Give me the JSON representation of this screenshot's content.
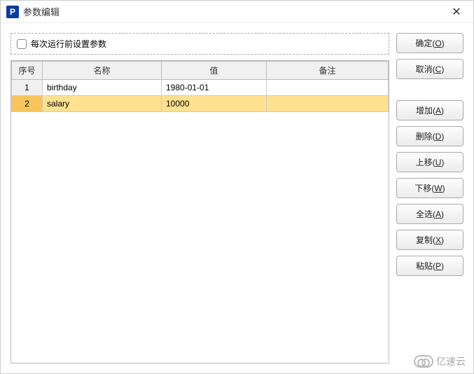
{
  "window": {
    "title": "参数编辑",
    "icon_letter": "P"
  },
  "checkbox": {
    "label": "每次运行前设置参数",
    "checked": false
  },
  "table": {
    "headers": {
      "seq": "序号",
      "name": "名称",
      "value": "值",
      "remark": "备注"
    },
    "rows": [
      {
        "seq": "1",
        "name": "birthday",
        "value": "1980-01-01",
        "remark": "",
        "selected": false
      },
      {
        "seq": "2",
        "name": "salary",
        "value": "10000",
        "remark": "",
        "selected": true
      }
    ]
  },
  "buttons": {
    "ok": {
      "text": "确定(",
      "key": "O",
      "suffix": ")"
    },
    "cancel": {
      "text": "取消(",
      "key": "C",
      "suffix": ")"
    },
    "add": {
      "text": "增加(",
      "key": "A",
      "suffix": ")"
    },
    "delete": {
      "text": "删除(",
      "key": "D",
      "suffix": ")"
    },
    "up": {
      "text": "上移(",
      "key": "U",
      "suffix": ")"
    },
    "down": {
      "text": "下移(",
      "key": "W",
      "suffix": ")"
    },
    "selall": {
      "text": "全选(",
      "key": "A",
      "suffix": ")"
    },
    "copy": {
      "text": "复制(",
      "key": "X",
      "suffix": ")"
    },
    "paste": {
      "text": "粘贴(",
      "key": "P",
      "suffix": ")"
    }
  },
  "watermark": {
    "text": "亿速云"
  }
}
